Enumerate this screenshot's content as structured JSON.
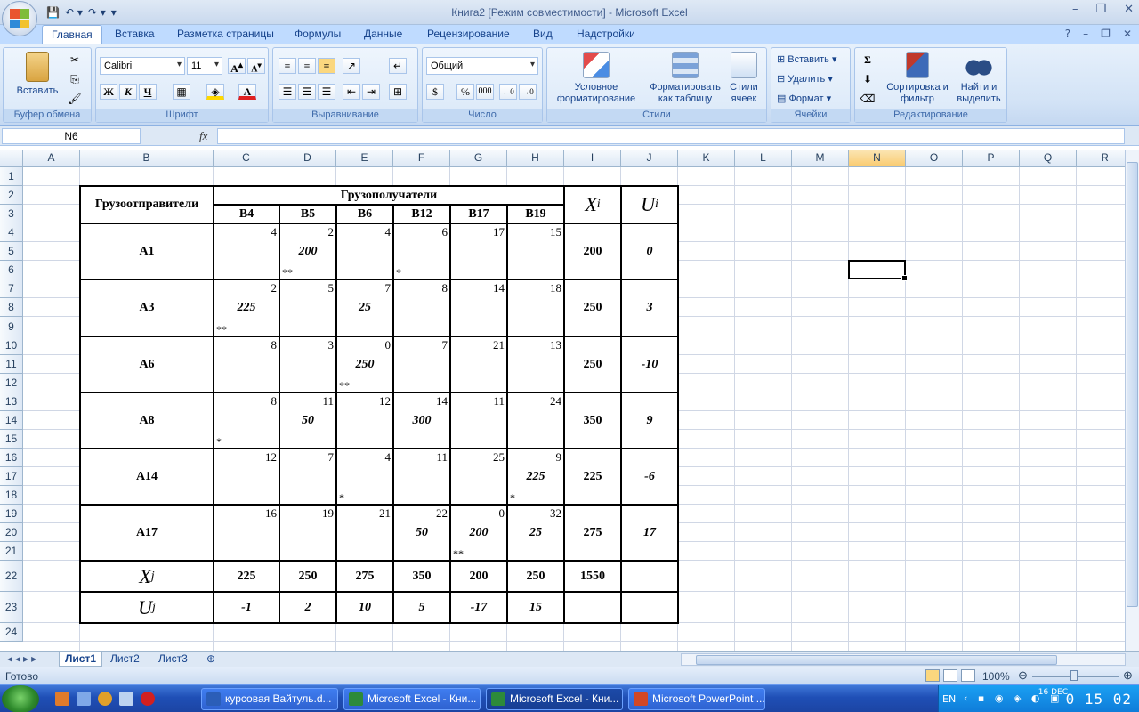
{
  "window": {
    "title": "Книга2  [Режим совместимости] - Microsoft Excel",
    "controls": [
      "–",
      "❐",
      "✕"
    ]
  },
  "ribbon_tabs": [
    "Главная",
    "Вставка",
    "Разметка страницы",
    "Формулы",
    "Данные",
    "Рецензирование",
    "Вид",
    "Надстройки"
  ],
  "ribbon": {
    "clipboard": {
      "paste": "Вставить",
      "label": "Буфер обмена"
    },
    "font": {
      "name": "Calibri",
      "size": "11",
      "bold": "Ж",
      "italic": "К",
      "underline": "Ч",
      "label": "Шрифт"
    },
    "alignment": {
      "label": "Выравнивание"
    },
    "number": {
      "format": "Общий",
      "percent": "%",
      "thousands": "000",
      "label": "Число"
    },
    "styles": {
      "conditional": "Условное форматирование",
      "as_table": "Форматировать как таблицу",
      "cell_styles": "Стили ячеек",
      "label": "Стили"
    },
    "cells": {
      "insert": "Вставить",
      "delete": "Удалить",
      "format": "Формат",
      "label": "Ячейки"
    },
    "editing": {
      "sort": "Сортировка и фильтр",
      "find": "Найти и выделить",
      "label": "Редактирование"
    }
  },
  "formula_bar": {
    "name_box": "N6",
    "fx": "fx",
    "content": ""
  },
  "columns": [
    "A",
    "B",
    "C",
    "D",
    "E",
    "F",
    "G",
    "H",
    "I",
    "J",
    "K",
    "L",
    "M",
    "N",
    "O",
    "P",
    "Q",
    "R"
  ],
  "selected_column": "N",
  "rows": [
    "1",
    "2",
    "3",
    "4",
    "5",
    "6",
    "7",
    "8",
    "9",
    "10",
    "11",
    "12",
    "13",
    "14",
    "15",
    "16",
    "17",
    "18",
    "19",
    "20",
    "21",
    "22",
    "23",
    "24"
  ],
  "selected_cell": "N6",
  "table": {
    "shippers_header": "Грузоотправители",
    "receivers_header": "Грузополучатели",
    "x_i": "X",
    "x_i_sub": "i",
    "u_i": "U",
    "u_i_sub": "i",
    "x_j": "X",
    "x_j_sub": "j",
    "u_j": "U",
    "u_j_sub": "j",
    "receivers": [
      "B4",
      "B5",
      "B6",
      "B12",
      "B17",
      "B19"
    ],
    "shippers": [
      {
        "name": "A1",
        "costs": [
          "4",
          "2",
          "4",
          "6",
          "17",
          "15"
        ],
        "alloc": [
          "",
          "200",
          "",
          "",
          "",
          ""
        ],
        "marks": [
          "",
          "**",
          "",
          "*",
          "",
          ""
        ],
        "supply": "200",
        "u": "0"
      },
      {
        "name": "A3",
        "costs": [
          "2",
          "5",
          "7",
          "8",
          "14",
          "18"
        ],
        "alloc": [
          "225",
          "",
          "25",
          "",
          "",
          ""
        ],
        "marks": [
          "**",
          "",
          "",
          "",
          "",
          ""
        ],
        "supply": "250",
        "u": "3"
      },
      {
        "name": "A6",
        "costs": [
          "8",
          "3",
          "0",
          "7",
          "21",
          "13"
        ],
        "alloc": [
          "",
          "",
          "250",
          "",
          "",
          ""
        ],
        "marks": [
          "",
          "",
          "**",
          "",
          "",
          ""
        ],
        "supply": "250",
        "u": "-10"
      },
      {
        "name": "A8",
        "costs": [
          "8",
          "11",
          "12",
          "14",
          "11",
          "24"
        ],
        "alloc": [
          "",
          "50",
          "",
          "300",
          "",
          ""
        ],
        "marks": [
          "*",
          "",
          "",
          "",
          "",
          ""
        ],
        "supply": "350",
        "u": "9"
      },
      {
        "name": "A14",
        "costs": [
          "12",
          "7",
          "4",
          "11",
          "25",
          "9"
        ],
        "alloc": [
          "",
          "",
          "",
          "",
          "",
          "225"
        ],
        "marks": [
          "",
          "",
          "*",
          "",
          "",
          "*"
        ],
        "supply": "225",
        "u": "-6"
      },
      {
        "name": "A17",
        "costs": [
          "16",
          "19",
          "21",
          "22",
          "0",
          "32"
        ],
        "alloc": [
          "",
          "",
          "",
          "50",
          "200",
          "25"
        ],
        "marks": [
          "",
          "",
          "",
          "",
          "**",
          ""
        ],
        "supply": "275",
        "u": "17"
      }
    ],
    "demand": [
      "225",
      "250",
      "275",
      "350",
      "200",
      "250"
    ],
    "total": "1550",
    "v": [
      "-1",
      "2",
      "10",
      "5",
      "-17",
      "15"
    ]
  },
  "sheets": [
    "Лист1",
    "Лист2",
    "Лист3"
  ],
  "active_sheet": "Лист1",
  "status": {
    "text": "Готово",
    "zoom": "100%"
  },
  "taskbar": {
    "buttons": [
      "курсовая Вайтуль.d...",
      "Microsoft Excel - Кни...",
      "Microsoft Excel - Кни...",
      "Microsoft PowerPoint ..."
    ],
    "lang": "EN",
    "date": "16 DEC",
    "time": "0 15 02"
  }
}
